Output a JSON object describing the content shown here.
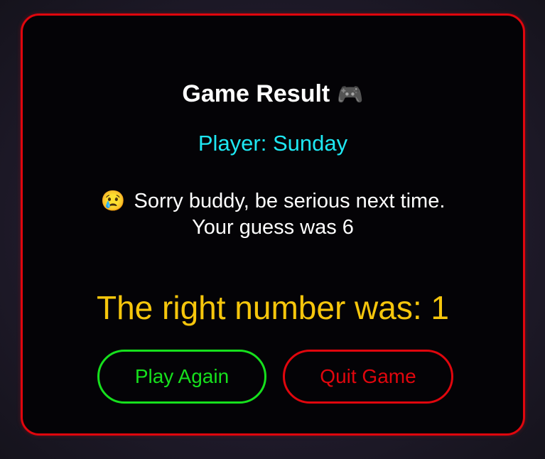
{
  "result": {
    "title": "Game Result",
    "title_icon": "🎮",
    "title_icon_name": "game-controller-icon",
    "player_label": "Player: Sunday",
    "message_icon": "😢",
    "message_icon_name": "crying-face-icon",
    "message_line1": "Sorry buddy, be serious next time.",
    "message_line2": "Your guess was 6",
    "answer_text": "The right number was: 1"
  },
  "actions": {
    "play_again_label": "Play Again",
    "quit_label": "Quit Game"
  },
  "colors": {
    "card_border": "#e0060d",
    "card_background": "#040306",
    "player_text": "#1ee7f2",
    "answer_text": "#f6c60c",
    "play_again": "#16e01d",
    "quit": "#e0060d"
  }
}
